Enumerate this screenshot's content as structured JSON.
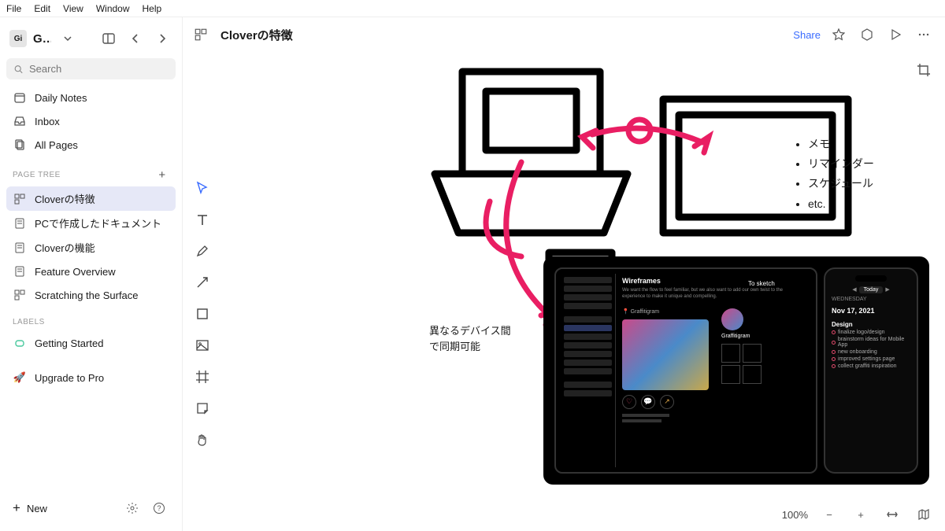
{
  "menu": [
    "File",
    "Edit",
    "View",
    "Window",
    "Help"
  ],
  "workspace": {
    "badge": "Gi",
    "name": "Gigagi..."
  },
  "search": {
    "placeholder": "Search"
  },
  "nav": {
    "daily": "Daily Notes",
    "inbox": "Inbox",
    "allpages": "All Pages"
  },
  "sections": {
    "pagetree": "PAGE TREE",
    "labels": "LABELS"
  },
  "pagetree": [
    {
      "label": "Cloverの特徴",
      "active": true
    },
    {
      "label": "PCで作成したドキュメント",
      "active": false
    },
    {
      "label": "Cloverの機能",
      "active": false
    },
    {
      "label": "Feature Overview",
      "active": false
    },
    {
      "label": "Scratching the Surface",
      "active": false
    }
  ],
  "labels": [
    {
      "label": "Getting Started"
    }
  ],
  "upgrade": "Upgrade to Pro",
  "new_label": "New",
  "doc": {
    "title": "Cloverの特徴"
  },
  "share": "Share",
  "canvas_note": {
    "l1": "異なるデバイス間",
    "l2": "で同期可能"
  },
  "bullets": [
    "メモ",
    "リマインダー",
    "スケジュール",
    "etc."
  ],
  "mock": {
    "wireframes": "Wireframes",
    "wf_sub": "We want the flow to feel familiar, but we also want to add our own twist to the experience to make it unique and compelling.",
    "tosketch": "To sketch",
    "graffitigram": "Graffitigram",
    "phone_date": "Nov 17, 2021",
    "phone_day": "WEDNESDAY",
    "phone_today": "Today",
    "design": "Design",
    "tasks": [
      "finalize logo/design",
      "brainstorm ideas for Mobile App",
      "new onboarding",
      "improved settings page",
      "collect graffiti inspiration"
    ]
  },
  "zoom": "100%"
}
